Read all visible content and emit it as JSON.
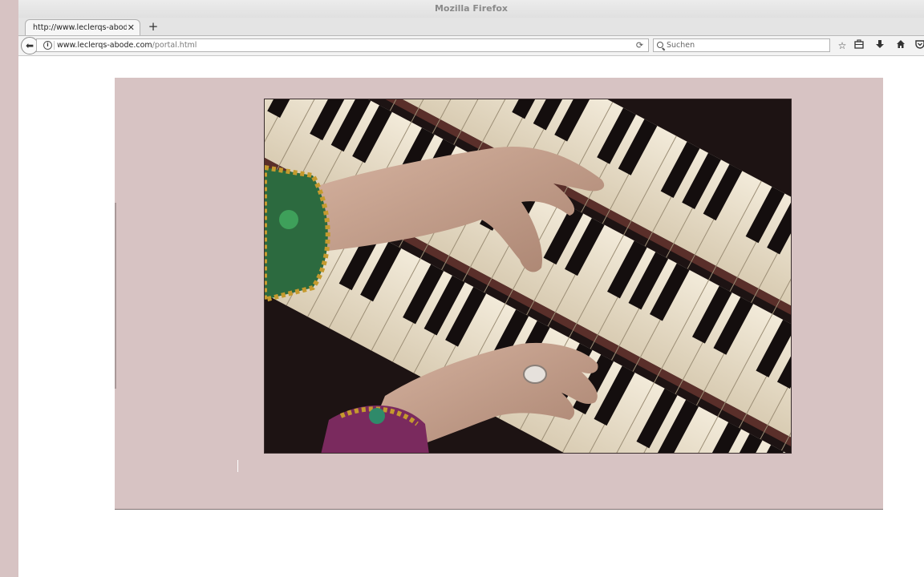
{
  "window": {
    "title": "Mozilla Firefox"
  },
  "tabs": [
    {
      "label": "http://www.leclerqs-abode.com/portal.html"
    }
  ],
  "toolbar": {
    "url_host": "www.leclerqs-abode.com",
    "url_path": "/portal.html",
    "search_placeholder": "Suchen",
    "icons": [
      "back-icon",
      "info-icon",
      "reload-icon",
      "search-icon",
      "bookmark-star-icon",
      "library-icon",
      "download-icon",
      "home-icon",
      "pocket-icon"
    ]
  },
  "page": {
    "background_color": "#d7c3c3",
    "panel_color": "#d7c3c3",
    "image_subject": "organ-keyboards-hands-image"
  }
}
